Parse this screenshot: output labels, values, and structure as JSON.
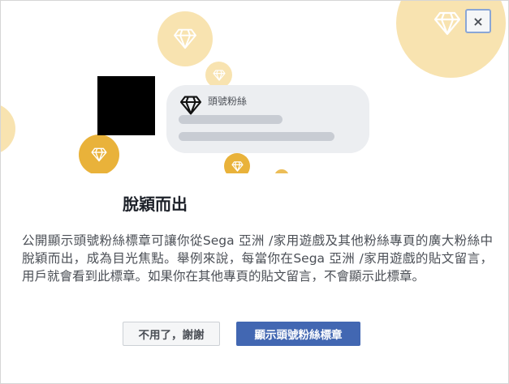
{
  "dialog": {
    "close_label": "×",
    "badge_label": "頭號粉絲",
    "title": "脫穎而出",
    "description": "公開顯示頭號粉絲標章可讓你從Sega 亞洲 /家用遊戲及其他粉絲專頁的廣大粉絲中脫穎而出，成為目光焦點。舉例來說，每當你在Sega 亞洲 /家用遊戲的貼文留言，用戶就會看到此標章。如果你在其他專頁的貼文留言，不會顯示此標章。",
    "cancel_label": "不用了，謝謝",
    "confirm_label": "顯示頭號粉絲標章"
  },
  "colors": {
    "primary": "#4267b2",
    "gold": "#e9b23a",
    "light_gold": "#f8e3b0"
  },
  "icons": [
    "close-icon",
    "diamond-icon"
  ]
}
